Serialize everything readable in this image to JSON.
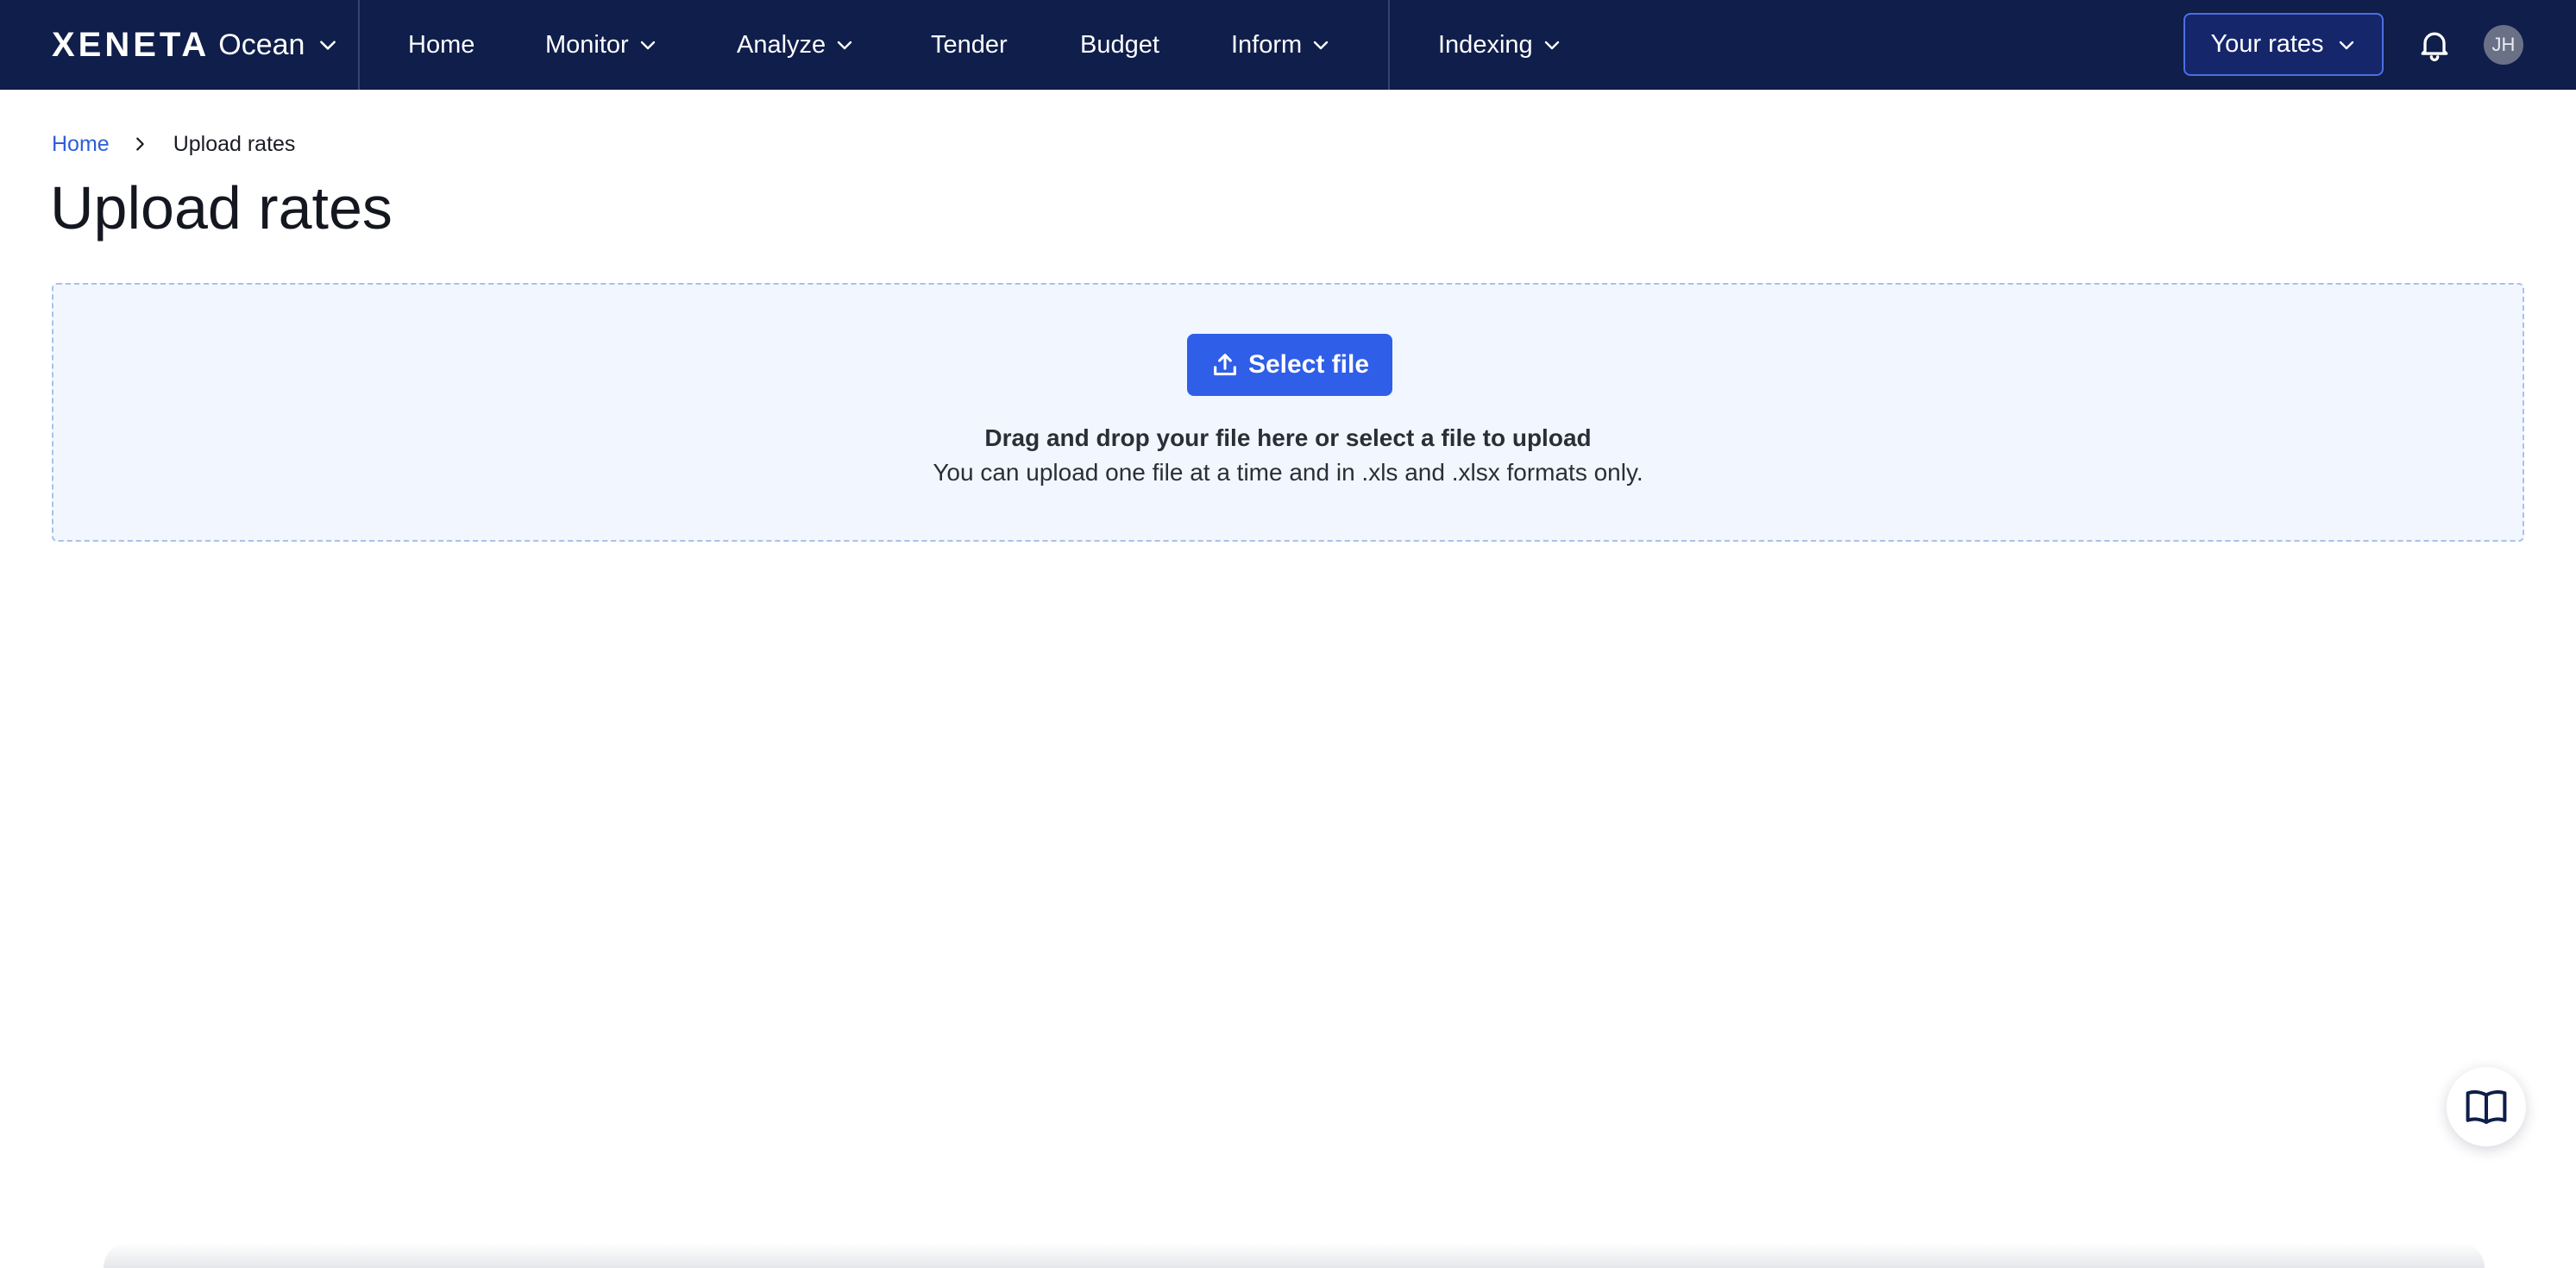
{
  "brand": {
    "logo": "XENETA",
    "product": "Ocean"
  },
  "nav": {
    "home": "Home",
    "monitor": "Monitor",
    "analyze": "Analyze",
    "tender": "Tender",
    "budget": "Budget",
    "inform": "Inform",
    "indexing": "Indexing"
  },
  "header": {
    "rates_button": "Your rates",
    "avatar_initials": "JH"
  },
  "breadcrumb": {
    "home": "Home",
    "current": "Upload rates"
  },
  "page": {
    "title": "Upload rates"
  },
  "upload": {
    "button_label": "Select file",
    "title": "Drag and drop your file here or select a file to upload",
    "subtitle": "You can upload one file at a time and in .xls and .xlsx formats only."
  },
  "colors": {
    "nav_background": "#0f1e4a",
    "accent": "#2f5ee8",
    "link": "#2c5fd9",
    "dropzone_background": "#f2f6ff",
    "dropzone_border": "#a9c1ea"
  },
  "icons": {
    "chevron": "chevron-down-icon",
    "breadcrumb_separator": "chevron-right-icon",
    "upload": "upload-icon",
    "notifications": "bell-icon",
    "help": "open-book-icon"
  }
}
